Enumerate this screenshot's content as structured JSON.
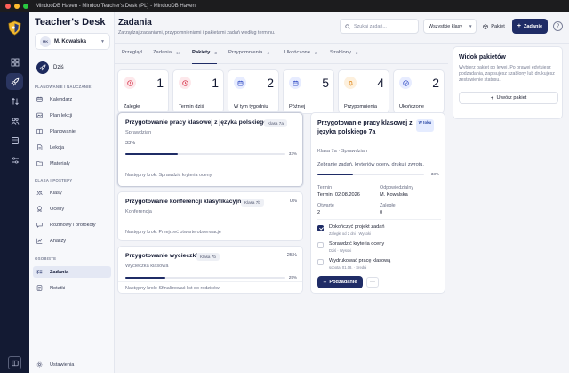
{
  "window": {
    "title": "MindooDB Haven - Mindoo Teacher's Desk (PL) - MindooDB Haven"
  },
  "sidebar": {
    "app_title": "Teacher's Desk",
    "user": {
      "initials": "MK",
      "name": "M. Kowalska"
    },
    "today_label": "Dziś",
    "sections": [
      {
        "title": "PLANOWANIE I NAUCZANIE",
        "items": [
          "Kalendarz",
          "Plan lekcji",
          "Planowanie",
          "Lekcja",
          "Materiały"
        ]
      },
      {
        "title": "KLASA I POSTĘPY",
        "items": [
          "Klasy",
          "Oceny",
          "Rozmowy i protokoły",
          "Analizy"
        ]
      },
      {
        "title": "OSOBISTE",
        "items": [
          "Zadania",
          "Notatki"
        ]
      }
    ],
    "settings_label": "Ustawienia"
  },
  "header": {
    "title": "Zadania",
    "subtitle": "Zarządzaj zadaniami, przypomnieniami i pakietami zadań według terminu.",
    "search_placeholder": "Szukaj zadań...",
    "class_filter": "Wszystkie klasy",
    "pakiet_label": "Pakiet",
    "new_task_label": "Zadanie",
    "help_label": "?"
  },
  "tabs": [
    {
      "label": "Przegląd",
      "count": ""
    },
    {
      "label": "Zadania",
      "count": "13"
    },
    {
      "label": "Pakiety",
      "count": "3"
    },
    {
      "label": "Przypomnienia",
      "count": "4"
    },
    {
      "label": "Ukończone",
      "count": "2"
    },
    {
      "label": "Szablony",
      "count": "2"
    }
  ],
  "stats": [
    {
      "label": "Zaległe",
      "value": "1",
      "color": "#d6344a",
      "bg": "#fde8eb",
      "icon": "alert-circle-icon"
    },
    {
      "label": "Termin dziś",
      "value": "1",
      "color": "#d6344a",
      "bg": "#fde8eb",
      "icon": "clock-icon"
    },
    {
      "label": "W tym tygodniu",
      "value": "2",
      "color": "#3b55c7",
      "bg": "#e7ecff",
      "icon": "calendar-icon"
    },
    {
      "label": "Później",
      "value": "5",
      "color": "#3b55c7",
      "bg": "#e7ecff",
      "icon": "calendar-icon"
    },
    {
      "label": "Przypomnienia",
      "value": "4",
      "color": "#e08a1e",
      "bg": "#fdf0dd",
      "icon": "bell-icon"
    },
    {
      "label": "Ukończone",
      "value": "2",
      "color": "#3b55c7",
      "bg": "#e7ecff",
      "icon": "check-circle-icon"
    }
  ],
  "packages": [
    {
      "title": "Przygotowanie pracy klasowej z języka polskiego 7a",
      "class": "Klasa 7a",
      "category": "Sprawdzian",
      "percent_left": "33%",
      "percent_right": "",
      "progress": 33,
      "bar_label": "33%",
      "next_step": "Następny krok: Sprawdzić kryteria oceny"
    },
    {
      "title": "Przygotowanie konferencji klasyfikacyjnej",
      "class": "Klasa 7b",
      "category": "Konferencja",
      "percent_left": "",
      "percent_right": "0%",
      "progress": 0,
      "bar_label": "",
      "next_step": "Następny krok: Przejrzeć otwarte obserwacje"
    },
    {
      "title": "Przygotowanie wycieczki 7b",
      "class": "Klasa 7b",
      "category": "Wycieczka klasowa",
      "percent_left": "",
      "percent_right": "25%",
      "progress": 25,
      "bar_label": "25%",
      "next_step": "Następny krok: Sfinalizować list do rodziców"
    }
  ],
  "detail": {
    "title": "Przygotowanie pracy klasowej z języka polskiego 7a",
    "badge": "W toku",
    "meta": "Klasa 7a · Sprawdzian",
    "description": "Zebranie zadań, kryteriów oceny, druku i zwrotu.",
    "progress": 33,
    "progress_label": "33%",
    "termin_label": "Termin",
    "termin_value": "Termin: 02.08.2026",
    "responsible_label": "Odpowiedzialny",
    "responsible_value": "M. Kowalska",
    "open_label": "Otwarte",
    "open_value": "2",
    "overdue_label": "Zaległe",
    "overdue_value": "0",
    "checklist": [
      {
        "title": "Dokończyć projekt zadań",
        "sub": "Zaległe od 2 dni · Wysoki",
        "done": true
      },
      {
        "title": "Sprawdzić kryteria oceny",
        "sub": "Dziś · Wysoki",
        "done": false
      },
      {
        "title": "Wydrukować pracę klasową",
        "sub": "sobota, 01.08. · Średni",
        "done": false
      }
    ],
    "add_subtask_label": "Podzadanie",
    "more_label": "···"
  },
  "package_view": {
    "title": "Widok pakietów",
    "description": "Wybierz pakiet po lewej. Po prawej edytujesz podzadania, zapisujesz szablony lub drukujesz zestawienie statusu.",
    "create_label": "Utwórz pakiet"
  },
  "colors": {
    "accent": "#1f2c66",
    "rail": "#131a33",
    "danger": "#d6344a",
    "info": "#3b55c7",
    "warning": "#e08a1e"
  }
}
